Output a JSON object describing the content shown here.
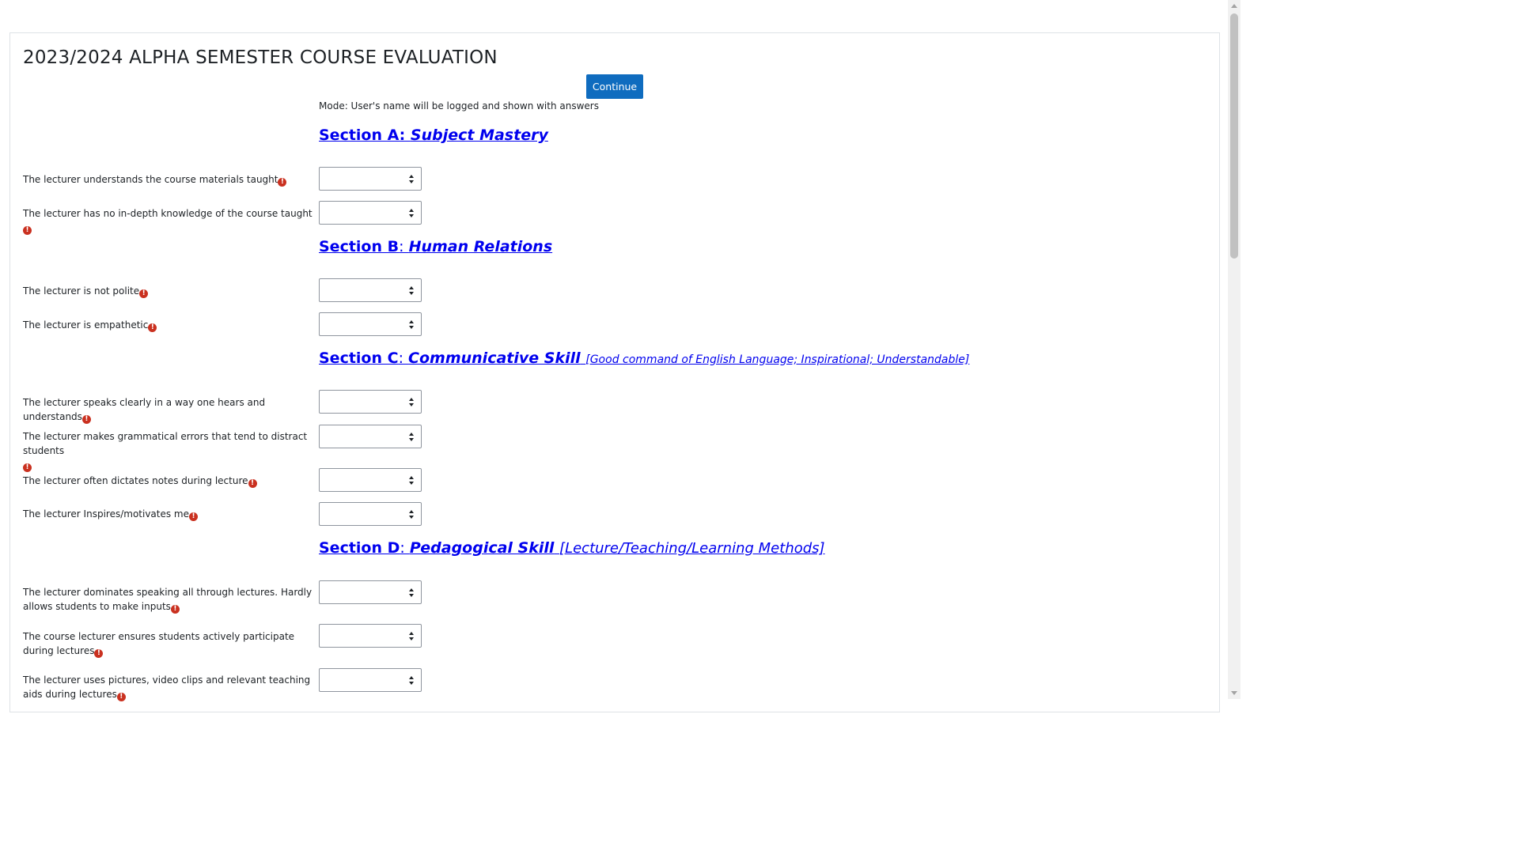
{
  "page": {
    "title": "2023/2024 ALPHA SEMESTER COURSE EVALUATION",
    "continue_label": "Continue",
    "mode_text": "Mode: User's name will be logged and shown with answers"
  },
  "sections": {
    "a": {
      "prefix": "Section A: ",
      "name": "Subject Mastery"
    },
    "b": {
      "prefix": "Section B",
      "sep": ": ",
      "name": "Human Relations"
    },
    "c": {
      "prefix": "Section C",
      "sep": ": ",
      "name": "Communicative Skill",
      "extra": "[Good command of English Language; Inspirational; Understandable]"
    },
    "d": {
      "prefix": "Section D",
      "sep": ": ",
      "name": "Pedagogical Skill",
      "extra": "[Lecture/Teaching/Learning Methods]"
    }
  },
  "questions": [
    {
      "label": "The lecturer understands the course materials taught",
      "selected": ""
    },
    {
      "label": "The lecturer has no in-depth knowledge of the course taught",
      "selected": ""
    },
    {
      "label": "The lecturer is not polite",
      "selected": ""
    },
    {
      "label": "The lecturer is empathetic",
      "selected": ""
    },
    {
      "label": "The lecturer speaks clearly in a way one hears and understands",
      "selected": ""
    },
    {
      "label": "The lecturer makes grammatical errors that tend to distract students",
      "selected": ""
    },
    {
      "label": "The lecturer often dictates notes during lecture",
      "selected": ""
    },
    {
      "label": "The lecturer Inspires/motivates me",
      "selected": ""
    },
    {
      "label": "The lecturer dominates speaking all through lectures. Hardly allows students to make inputs",
      "selected": ""
    },
    {
      "label": "The course lecturer ensures students actively participate during lectures",
      "selected": ""
    },
    {
      "label": "The lecturer uses pictures, video clips and relevant teaching aids during lectures",
      "selected": ""
    }
  ],
  "required_icon": "!",
  "colors": {
    "button": "#0f6cbf",
    "link": "#0000ee",
    "required": "#ca3120"
  },
  "icons": {
    "required": "exclamation-circle-icon",
    "select_arrows": "up-down-arrows-icon"
  }
}
